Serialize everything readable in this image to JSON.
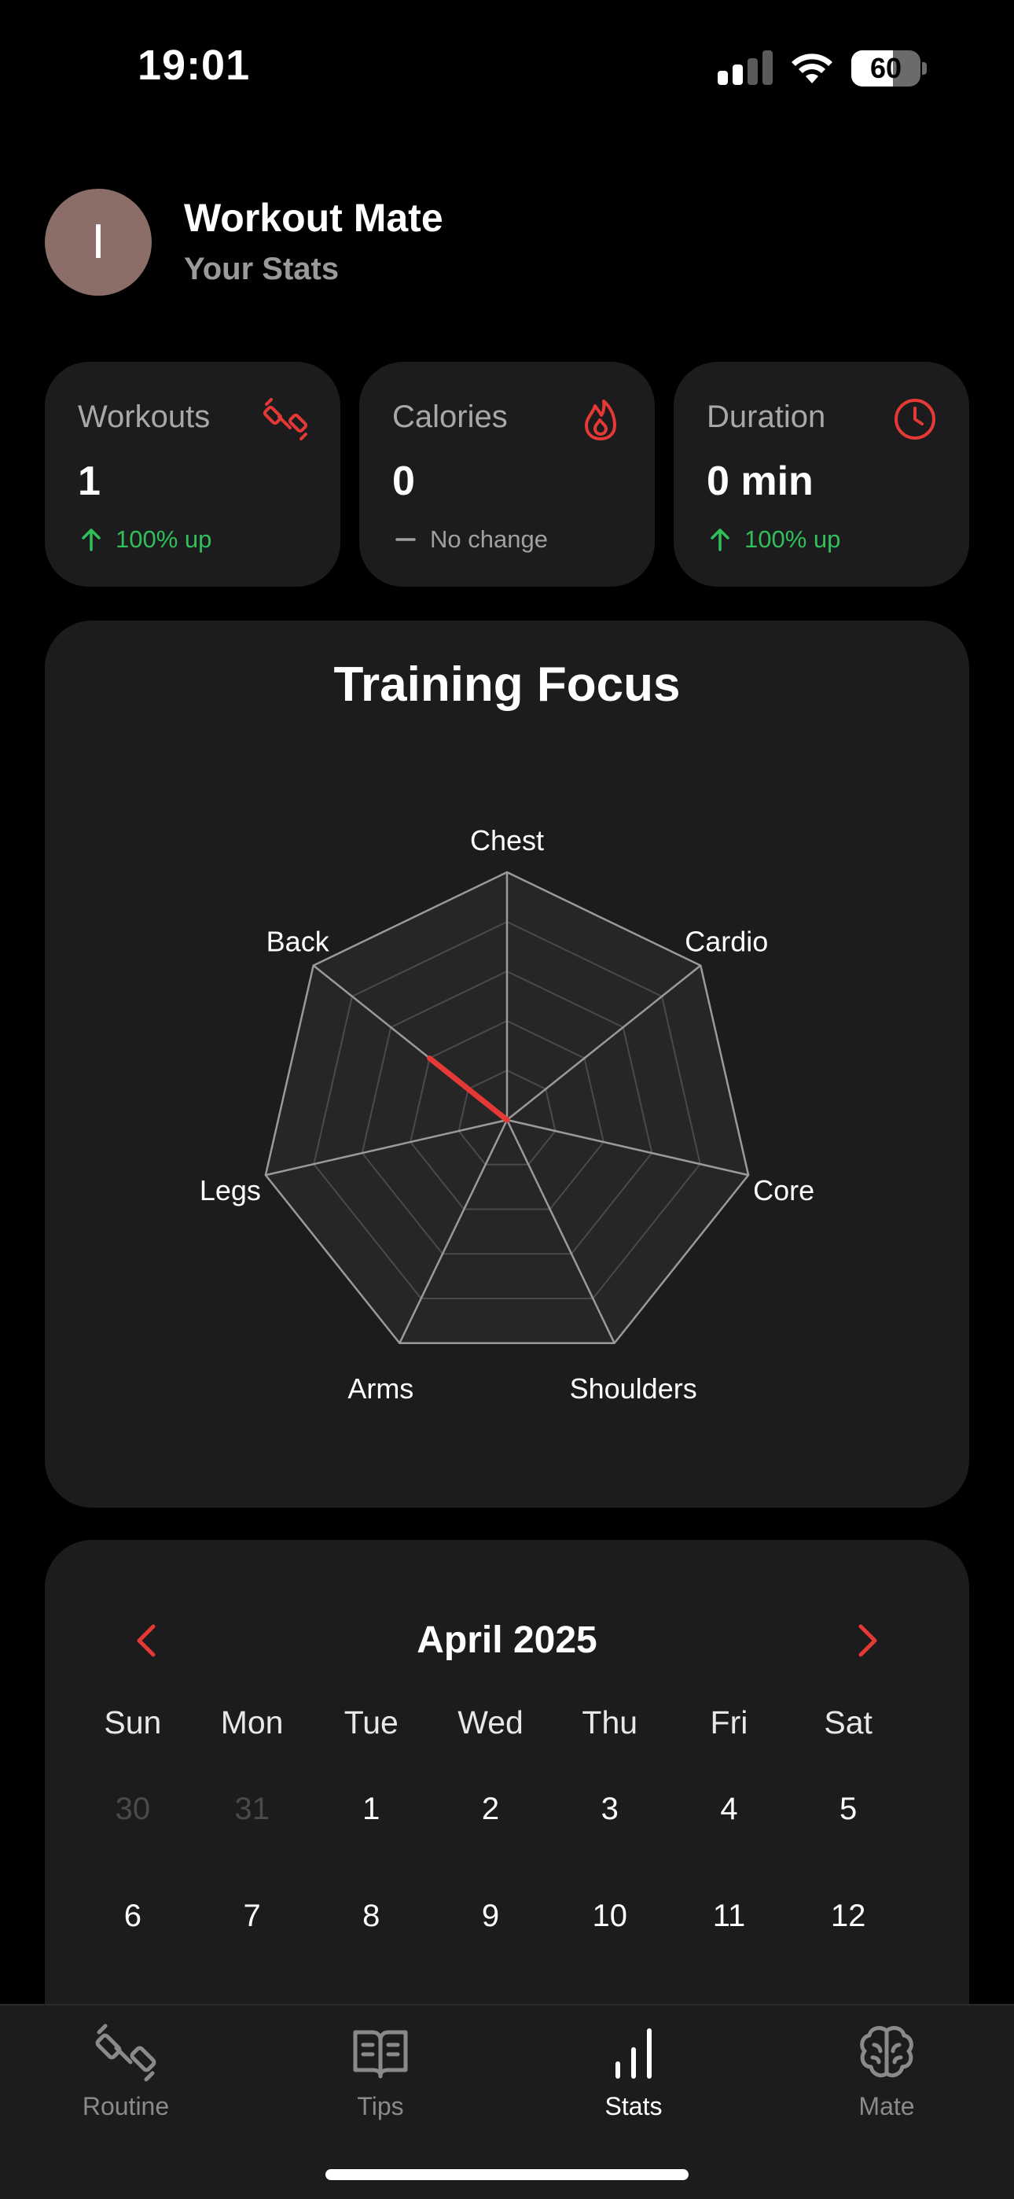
{
  "status_bar": {
    "time": "19:01",
    "battery_percent": "60",
    "battery_level": 0.6,
    "signal_bars_active": 2
  },
  "header": {
    "avatar_initial": "I",
    "title": "Workout Mate",
    "subtitle": "Your Stats"
  },
  "stats": [
    {
      "label": "Workouts",
      "value": "1",
      "delta": "100% up",
      "trend": "up",
      "icon": "dumbbell-icon"
    },
    {
      "label": "Calories",
      "value": "0",
      "delta": "No change",
      "trend": "flat",
      "icon": "flame-icon"
    },
    {
      "label": "Duration",
      "value": "0 min",
      "delta": "100% up",
      "trend": "up",
      "icon": "clock-icon"
    }
  ],
  "training_focus": {
    "title": "Training Focus",
    "axes": [
      "Chest",
      "Cardio",
      "Core",
      "Shoulders",
      "Arms",
      "Legs",
      "Back"
    ],
    "values": [
      0,
      0,
      0,
      0,
      0,
      0,
      0.4
    ],
    "max": 1,
    "accent_color": "#e53935"
  },
  "calendar": {
    "month": "April 2025",
    "weekdays": [
      "Sun",
      "Mon",
      "Tue",
      "Wed",
      "Thu",
      "Fri",
      "Sat"
    ],
    "weeks": [
      [
        "30",
        "31",
        "1",
        "2",
        "3",
        "4",
        "5"
      ],
      [
        "6",
        "7",
        "8",
        "9",
        "10",
        "11",
        "12"
      ]
    ],
    "outside_month": [
      "30",
      "31"
    ]
  },
  "tabs": [
    {
      "label": "Routine",
      "icon": "dumbbell-icon",
      "active": false
    },
    {
      "label": "Tips",
      "icon": "book-icon",
      "active": false
    },
    {
      "label": "Stats",
      "icon": "bar-chart-icon",
      "active": true
    },
    {
      "label": "Mate",
      "icon": "brain-icon",
      "active": false
    }
  ],
  "colors": {
    "accent": "#e53935",
    "up": "#30c05a",
    "card": "#1c1c1e",
    "background": "#000000"
  }
}
